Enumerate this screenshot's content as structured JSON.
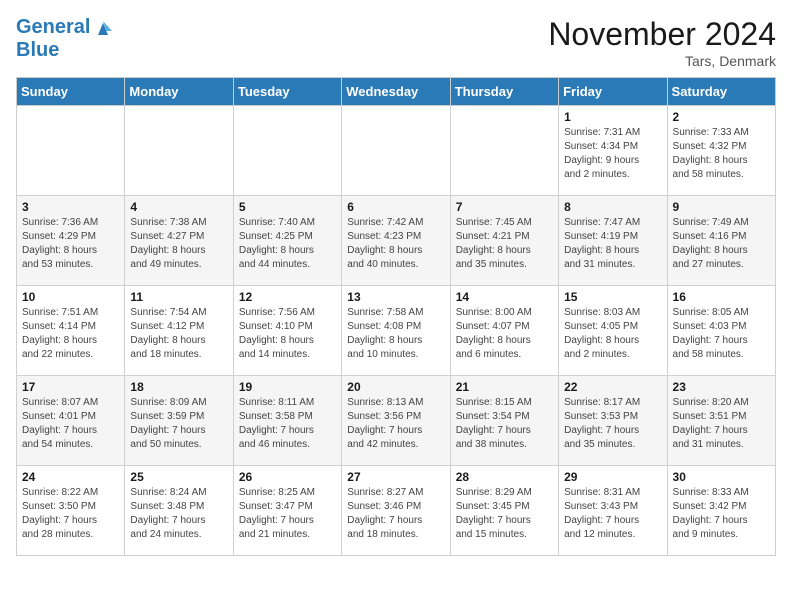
{
  "header": {
    "logo_line1": "General",
    "logo_line2": "Blue",
    "month": "November 2024",
    "location": "Tars, Denmark"
  },
  "days_of_week": [
    "Sunday",
    "Monday",
    "Tuesday",
    "Wednesday",
    "Thursday",
    "Friday",
    "Saturday"
  ],
  "weeks": [
    [
      {
        "day": "",
        "info": ""
      },
      {
        "day": "",
        "info": ""
      },
      {
        "day": "",
        "info": ""
      },
      {
        "day": "",
        "info": ""
      },
      {
        "day": "",
        "info": ""
      },
      {
        "day": "1",
        "info": "Sunrise: 7:31 AM\nSunset: 4:34 PM\nDaylight: 9 hours\nand 2 minutes."
      },
      {
        "day": "2",
        "info": "Sunrise: 7:33 AM\nSunset: 4:32 PM\nDaylight: 8 hours\nand 58 minutes."
      }
    ],
    [
      {
        "day": "3",
        "info": "Sunrise: 7:36 AM\nSunset: 4:29 PM\nDaylight: 8 hours\nand 53 minutes."
      },
      {
        "day": "4",
        "info": "Sunrise: 7:38 AM\nSunset: 4:27 PM\nDaylight: 8 hours\nand 49 minutes."
      },
      {
        "day": "5",
        "info": "Sunrise: 7:40 AM\nSunset: 4:25 PM\nDaylight: 8 hours\nand 44 minutes."
      },
      {
        "day": "6",
        "info": "Sunrise: 7:42 AM\nSunset: 4:23 PM\nDaylight: 8 hours\nand 40 minutes."
      },
      {
        "day": "7",
        "info": "Sunrise: 7:45 AM\nSunset: 4:21 PM\nDaylight: 8 hours\nand 35 minutes."
      },
      {
        "day": "8",
        "info": "Sunrise: 7:47 AM\nSunset: 4:19 PM\nDaylight: 8 hours\nand 31 minutes."
      },
      {
        "day": "9",
        "info": "Sunrise: 7:49 AM\nSunset: 4:16 PM\nDaylight: 8 hours\nand 27 minutes."
      }
    ],
    [
      {
        "day": "10",
        "info": "Sunrise: 7:51 AM\nSunset: 4:14 PM\nDaylight: 8 hours\nand 22 minutes."
      },
      {
        "day": "11",
        "info": "Sunrise: 7:54 AM\nSunset: 4:12 PM\nDaylight: 8 hours\nand 18 minutes."
      },
      {
        "day": "12",
        "info": "Sunrise: 7:56 AM\nSunset: 4:10 PM\nDaylight: 8 hours\nand 14 minutes."
      },
      {
        "day": "13",
        "info": "Sunrise: 7:58 AM\nSunset: 4:08 PM\nDaylight: 8 hours\nand 10 minutes."
      },
      {
        "day": "14",
        "info": "Sunrise: 8:00 AM\nSunset: 4:07 PM\nDaylight: 8 hours\nand 6 minutes."
      },
      {
        "day": "15",
        "info": "Sunrise: 8:03 AM\nSunset: 4:05 PM\nDaylight: 8 hours\nand 2 minutes."
      },
      {
        "day": "16",
        "info": "Sunrise: 8:05 AM\nSunset: 4:03 PM\nDaylight: 7 hours\nand 58 minutes."
      }
    ],
    [
      {
        "day": "17",
        "info": "Sunrise: 8:07 AM\nSunset: 4:01 PM\nDaylight: 7 hours\nand 54 minutes."
      },
      {
        "day": "18",
        "info": "Sunrise: 8:09 AM\nSunset: 3:59 PM\nDaylight: 7 hours\nand 50 minutes."
      },
      {
        "day": "19",
        "info": "Sunrise: 8:11 AM\nSunset: 3:58 PM\nDaylight: 7 hours\nand 46 minutes."
      },
      {
        "day": "20",
        "info": "Sunrise: 8:13 AM\nSunset: 3:56 PM\nDaylight: 7 hours\nand 42 minutes."
      },
      {
        "day": "21",
        "info": "Sunrise: 8:15 AM\nSunset: 3:54 PM\nDaylight: 7 hours\nand 38 minutes."
      },
      {
        "day": "22",
        "info": "Sunrise: 8:17 AM\nSunset: 3:53 PM\nDaylight: 7 hours\nand 35 minutes."
      },
      {
        "day": "23",
        "info": "Sunrise: 8:20 AM\nSunset: 3:51 PM\nDaylight: 7 hours\nand 31 minutes."
      }
    ],
    [
      {
        "day": "24",
        "info": "Sunrise: 8:22 AM\nSunset: 3:50 PM\nDaylight: 7 hours\nand 28 minutes."
      },
      {
        "day": "25",
        "info": "Sunrise: 8:24 AM\nSunset: 3:48 PM\nDaylight: 7 hours\nand 24 minutes."
      },
      {
        "day": "26",
        "info": "Sunrise: 8:25 AM\nSunset: 3:47 PM\nDaylight: 7 hours\nand 21 minutes."
      },
      {
        "day": "27",
        "info": "Sunrise: 8:27 AM\nSunset: 3:46 PM\nDaylight: 7 hours\nand 18 minutes."
      },
      {
        "day": "28",
        "info": "Sunrise: 8:29 AM\nSunset: 3:45 PM\nDaylight: 7 hours\nand 15 minutes."
      },
      {
        "day": "29",
        "info": "Sunrise: 8:31 AM\nSunset: 3:43 PM\nDaylight: 7 hours\nand 12 minutes."
      },
      {
        "day": "30",
        "info": "Sunrise: 8:33 AM\nSunset: 3:42 PM\nDaylight: 7 hours\nand 9 minutes."
      }
    ]
  ]
}
